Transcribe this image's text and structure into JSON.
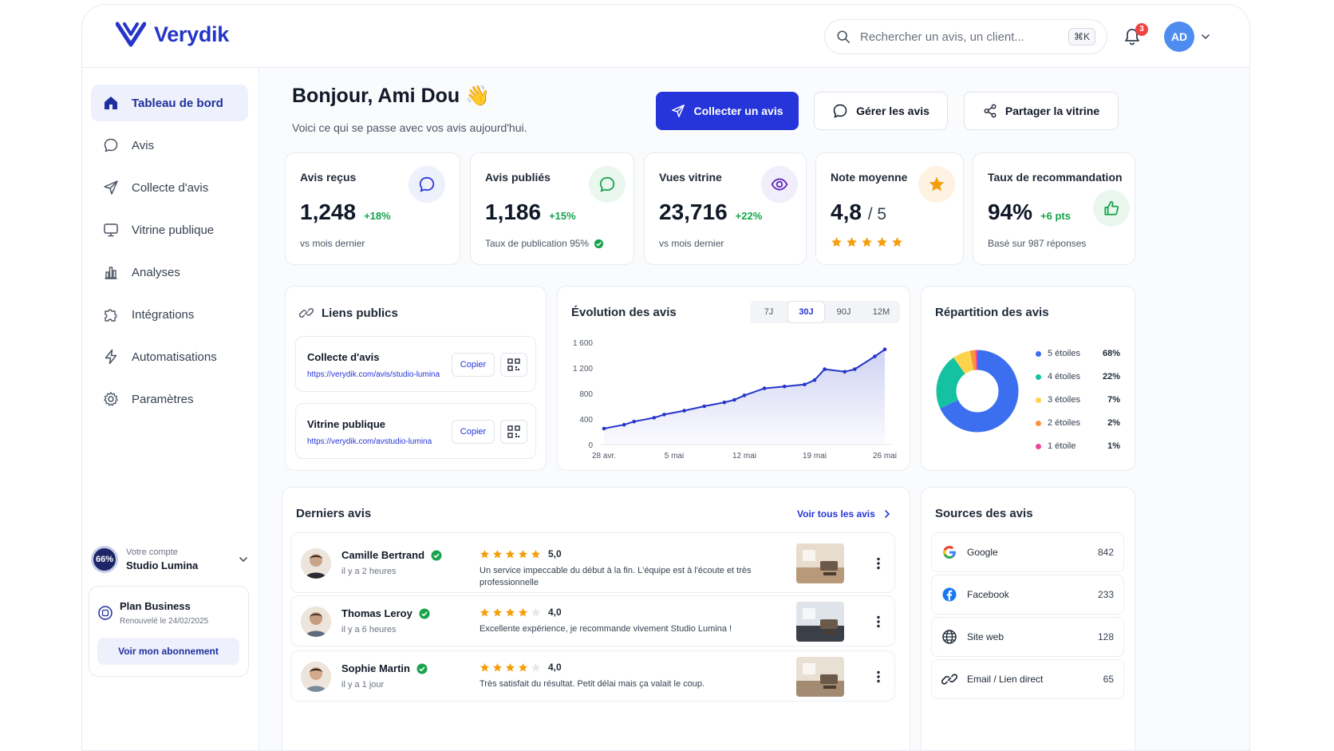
{
  "brand": {
    "name": "Verydik"
  },
  "search": {
    "placeholder": "Rechercher un avis, un client...",
    "shortcut": "⌘K"
  },
  "notifications": {
    "count": "3"
  },
  "user": {
    "initials": "AD"
  },
  "sidebar": {
    "items": [
      {
        "label": "Tableau de bord",
        "icon": "home-icon",
        "active": true
      },
      {
        "label": "Avis",
        "icon": "chat-bubble-icon"
      },
      {
        "label": "Collecte d'avis",
        "icon": "send-icon"
      },
      {
        "label": "Vitrine publique",
        "icon": "monitor-icon"
      },
      {
        "label": "Analyses",
        "icon": "bar-chart-icon"
      },
      {
        "label": "Intégrations",
        "icon": "puzzle-icon"
      },
      {
        "label": "Automatisations",
        "icon": "lightning-icon"
      },
      {
        "label": "Paramètres",
        "icon": "gear-icon"
      }
    ],
    "account": {
      "progress": "66%",
      "label": "Votre compte",
      "name": "Studio Lumina"
    },
    "plan": {
      "name": "Plan Business",
      "renewal": "Renouvelé le 24/02/2025",
      "button": "Voir mon abonnement"
    }
  },
  "header": {
    "greeting": "Bonjour, Ami Dou",
    "emoji": "👋",
    "subtitle": "Voici ce qui se passe avec vos avis aujourd'hui.",
    "actions": {
      "collect": "Collecter un avis",
      "manage": "Gérer les avis",
      "share": "Partager la vitrine"
    }
  },
  "kpis": [
    {
      "title": "Avis reçus",
      "value": "1,248",
      "delta": "+18%",
      "sub": "vs mois dernier",
      "color": "#2535d9"
    },
    {
      "title": "Avis publiés",
      "value": "1,186",
      "delta": "+15%",
      "sub": "Taux de publication 95%",
      "color": "#16a34a"
    },
    {
      "title": "Vues vitrine",
      "value": "23,716",
      "delta": "+22%",
      "sub": "vs mois dernier",
      "color": "#5b21b6"
    },
    {
      "title": "Note moyenne",
      "value": "4,8",
      "suffix": "/ 5",
      "rating": 5,
      "color": "#f59e0b"
    },
    {
      "title": "Taux de recommandation",
      "value": "94%",
      "delta": "+6 pts",
      "sub": "Basé sur 987 réponses",
      "color": "#16a34a"
    }
  ],
  "links": {
    "title": "Liens publics",
    "items": [
      {
        "name": "Collecte d'avis",
        "url": "https://verydik.com/avis/studio-lumina",
        "copy": "Copier"
      },
      {
        "name": "Vitrine publique",
        "url": "https://verydik.com/avstudio-lumina",
        "copy": "Copier"
      }
    ]
  },
  "evolution": {
    "title": "Évolution des avis",
    "tabs": [
      "7J",
      "30J",
      "90J",
      "12M"
    ],
    "active_tab": "30J"
  },
  "chart_data": [
    {
      "type": "area",
      "title": "Évolution des avis",
      "x_ticks": [
        "28 avr.",
        "5 mai",
        "12 mai",
        "19 mai",
        "26 mai"
      ],
      "y_ticks": [
        "1 600",
        "1 200",
        "800",
        "400",
        "0"
      ],
      "ylim": [
        0,
        1600
      ],
      "xlim": [
        0,
        28
      ],
      "x": [
        0,
        2,
        3,
        5,
        6,
        8,
        10,
        12,
        13,
        14,
        16,
        18,
        20,
        21,
        22,
        24,
        25,
        27,
        28
      ],
      "values": [
        250,
        310,
        360,
        420,
        470,
        530,
        600,
        660,
        700,
        770,
        880,
        910,
        940,
        1010,
        1180,
        1140,
        1180,
        1380,
        1490
      ],
      "grid": false,
      "color": "#2535c9"
    },
    {
      "type": "pie",
      "title": "Répartition des avis",
      "categories": [
        "5 étoiles",
        "4 étoiles",
        "3 étoiles",
        "2 étoiles",
        "1 étoile"
      ],
      "values": [
        68,
        22,
        7,
        2,
        1
      ],
      "labels": [
        "68%",
        "22%",
        "7%",
        "2%",
        "1%"
      ],
      "colors": [
        "#3b6ff0",
        "#14c1a0",
        "#fcd34d",
        "#fb923c",
        "#ec4899"
      ],
      "legend": "right"
    }
  ],
  "reviews": {
    "title": "Derniers avis",
    "see_all": "Voir tous les avis",
    "items": [
      {
        "name": "Camille Bertrand",
        "time": "il y a 2 heures",
        "rating": 5,
        "score": "5,0",
        "text": "Un service impeccable du début à la fin. L'équipe est à l'écoute et très professionnelle"
      },
      {
        "name": "Thomas Leroy",
        "time": "il y a 6 heures",
        "rating": 4,
        "score": "4,0",
        "text": "Excellente expérience, je recommande vivement Studio Lumina !"
      },
      {
        "name": "Sophie Martin",
        "time": "il y a 1 jour",
        "rating": 4,
        "score": "4,0",
        "text": "Très satisfait du résultat. Petit délai mais ça valait le coup."
      }
    ]
  },
  "sources": {
    "title": "Sources des avis",
    "items": [
      {
        "name": "Google",
        "count": "842",
        "icon": "google-icon"
      },
      {
        "name": "Facebook",
        "count": "233",
        "icon": "facebook-icon"
      },
      {
        "name": "Site web",
        "count": "128",
        "icon": "globe-icon"
      },
      {
        "name": "Email / Lien direct",
        "count": "65",
        "icon": "link-icon"
      }
    ]
  }
}
